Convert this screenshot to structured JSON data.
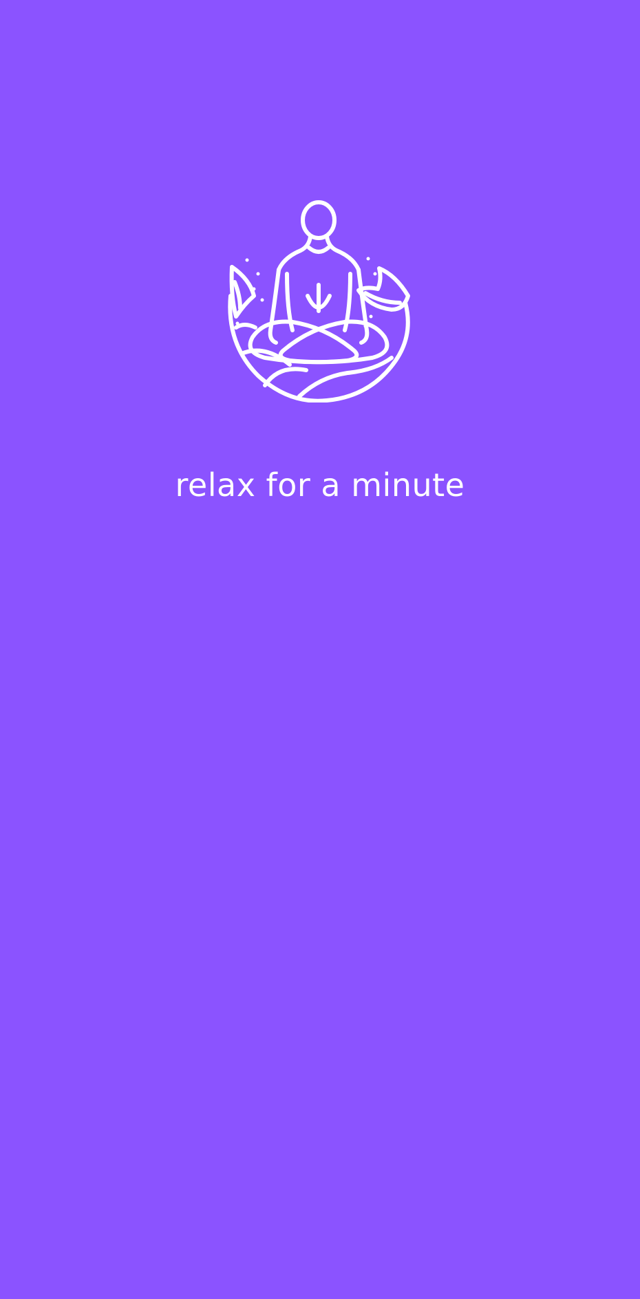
{
  "splash": {
    "background_color": "#8b53ff",
    "logo": {
      "icon": "meditation-figure-icon",
      "color": "#ffffff"
    },
    "tagline": "relax for a minute"
  }
}
